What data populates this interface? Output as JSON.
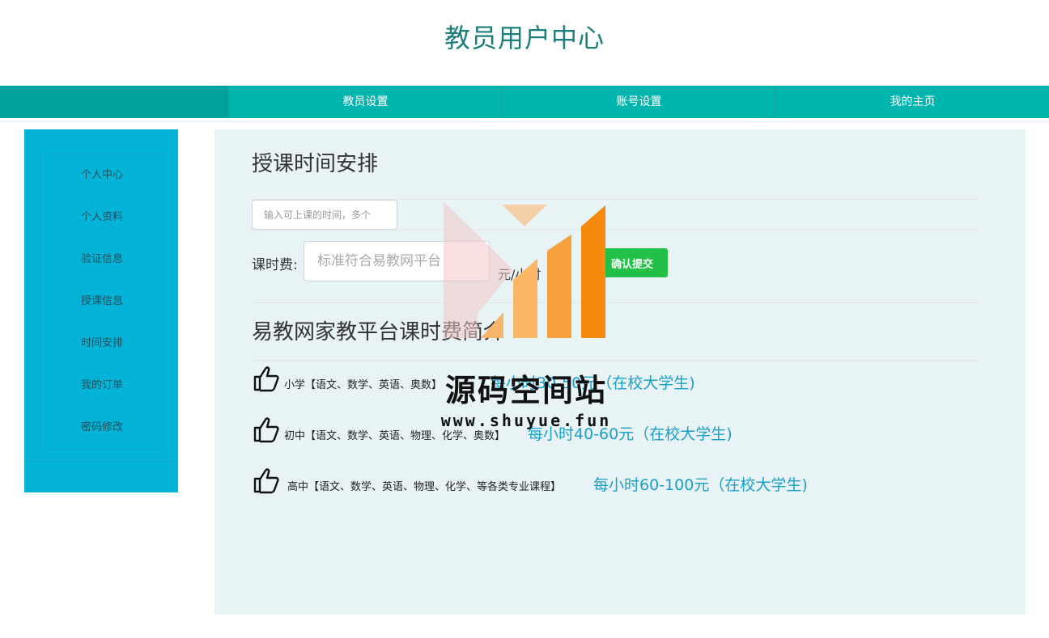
{
  "header": {
    "title": "教员用户中心"
  },
  "topnav": {
    "items": [
      "教员设置",
      "账号设置",
      "我的主页"
    ]
  },
  "sidebar": {
    "items": [
      "个人中心",
      "个人资料",
      "验证信息",
      "授课信息",
      "时间安排",
      "我的订单",
      "密码修改"
    ]
  },
  "schedule": {
    "heading": "授课时间安排",
    "time_placeholder": "输入可上课的时间，多个",
    "fee_label": "课时费:",
    "fee_placeholder": "标准符合易教网平台",
    "fee_unit": "元/小时",
    "submit_label": "确认提交"
  },
  "pricing": {
    "heading": "易教网家教平台课时费简介",
    "rows": [
      {
        "desc": "小学【语文、数学、英语、奥数】",
        "value": "每小时30-50元（在校大学生)"
      },
      {
        "desc": "初中【语文、数学、英语、物理、化学、奥数】",
        "value": "每小时40-60元（在校大学生)"
      },
      {
        "desc": "高中【语文、数学、英语、物理、化学、等各类专业课程】",
        "value": "每小时60-100元（在校大学生)"
      }
    ]
  },
  "watermark": {
    "title": "源码空间站",
    "url": "www.shuyue.fun"
  },
  "icons": {
    "price_row_icon": "thumbs-up-icon"
  },
  "colors": {
    "accent": "#00b5ad",
    "sidebar": "#04b3d8",
    "submit": "#22c046",
    "price": "#1aa0c8"
  }
}
